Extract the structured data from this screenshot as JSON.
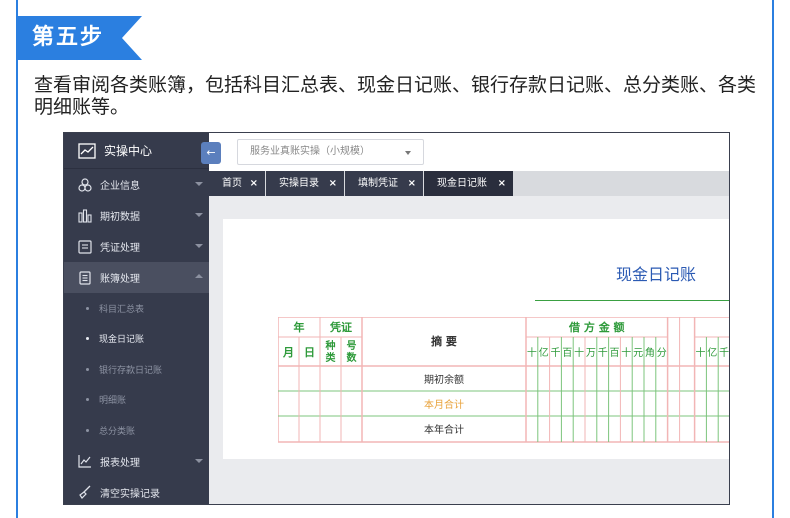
{
  "step": {
    "label": "第五步"
  },
  "description": "查看审阅各类账簿，包括科目汇总表、现金日记账、银行存款日记账、总分类账、各类明细账等。",
  "sidebar": {
    "title": "实操中心",
    "items": [
      {
        "label": "企业信息",
        "icon": "org-icon"
      },
      {
        "label": "期初数据",
        "icon": "bar-chart-icon"
      },
      {
        "label": "凭证处理",
        "icon": "voucher-icon"
      },
      {
        "label": "账簿处理",
        "icon": "ledger-icon"
      }
    ],
    "sub_items": [
      "科目汇总表",
      "现金日记账",
      "银行存款日记账",
      "明细账",
      "总分类账"
    ],
    "bottom_items": [
      {
        "label": "报表处理",
        "icon": "line-chart-icon"
      },
      {
        "label": "清空实操记录",
        "icon": "broom-icon"
      }
    ]
  },
  "topbar": {
    "collapse_glyph": "←",
    "selector_value": "服务业真账实操（小规模）"
  },
  "tabs": [
    {
      "label": "首页",
      "close": "×"
    },
    {
      "label": "实操目录",
      "close": "×"
    },
    {
      "label": "填制凭证",
      "close": "×"
    },
    {
      "label": "现金日记账",
      "close": "×"
    }
  ],
  "ledger": {
    "title": "现金日记账",
    "headers": {
      "year": "年",
      "voucher": "凭证",
      "month": "月",
      "day": "日",
      "type": "种类",
      "number": "号数",
      "summary": "摘 要",
      "debit": "借 方 金 额",
      "credit_partial": "贷",
      "digits": [
        "十",
        "亿",
        "千",
        "百",
        "十",
        "万",
        "千",
        "百",
        "十",
        "元",
        "角",
        "分"
      ],
      "digits_partial": [
        "十",
        "亿",
        "千",
        "百"
      ]
    },
    "rows": [
      "期初余额",
      "本月合计",
      "本年合计"
    ],
    "colors": {
      "grid_red": "#f2b5b5",
      "grid_green": "#7cc47c",
      "header_text": "#2e9a3a",
      "month_total": "#e8a23a"
    }
  }
}
